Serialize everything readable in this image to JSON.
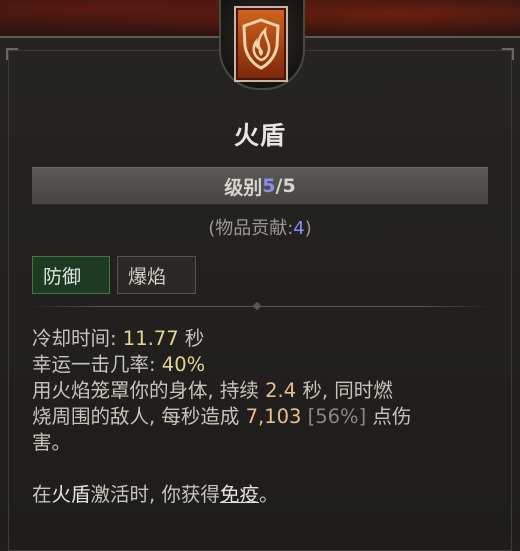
{
  "skill": {
    "name": "火盾",
    "rank_label": "级别",
    "rank_current": "5",
    "rank_sep": "/",
    "rank_max": "5",
    "contrib_prefix": "(物品贡献:",
    "contrib_value": "4",
    "contrib_suffix": ")",
    "tags": [
      "防御",
      "爆焰"
    ],
    "icon": "fire-shield-icon",
    "colors": {
      "accent_blue": "#8b8bf0",
      "value_yellow": "#e2d68a",
      "value_orange": "#e6c08a",
      "tag_active": "#1e3a22"
    }
  },
  "stats": {
    "cooldown_label": "冷却时间: ",
    "cooldown_value": "11.77",
    "cooldown_unit": " 秒",
    "lucky_label": "幸运一击几率: ",
    "lucky_value": "40%"
  },
  "description": {
    "l1_a": "用火焰笼罩你的身体, 持续 ",
    "l1_dur": "2.4",
    "l1_b": " 秒, 同时燃",
    "l2_a": "烧周围的敌人, 每秒造成 ",
    "l2_dmg": "7,103",
    "l2_pct": " [56%]",
    "l2_b": " 点伤",
    "l3": "害。",
    "l4_a": "在",
    "l4_skill": "火盾",
    "l4_b": "激活时, 你获得",
    "l4_keyword": "免疫",
    "l4_c": "。"
  }
}
